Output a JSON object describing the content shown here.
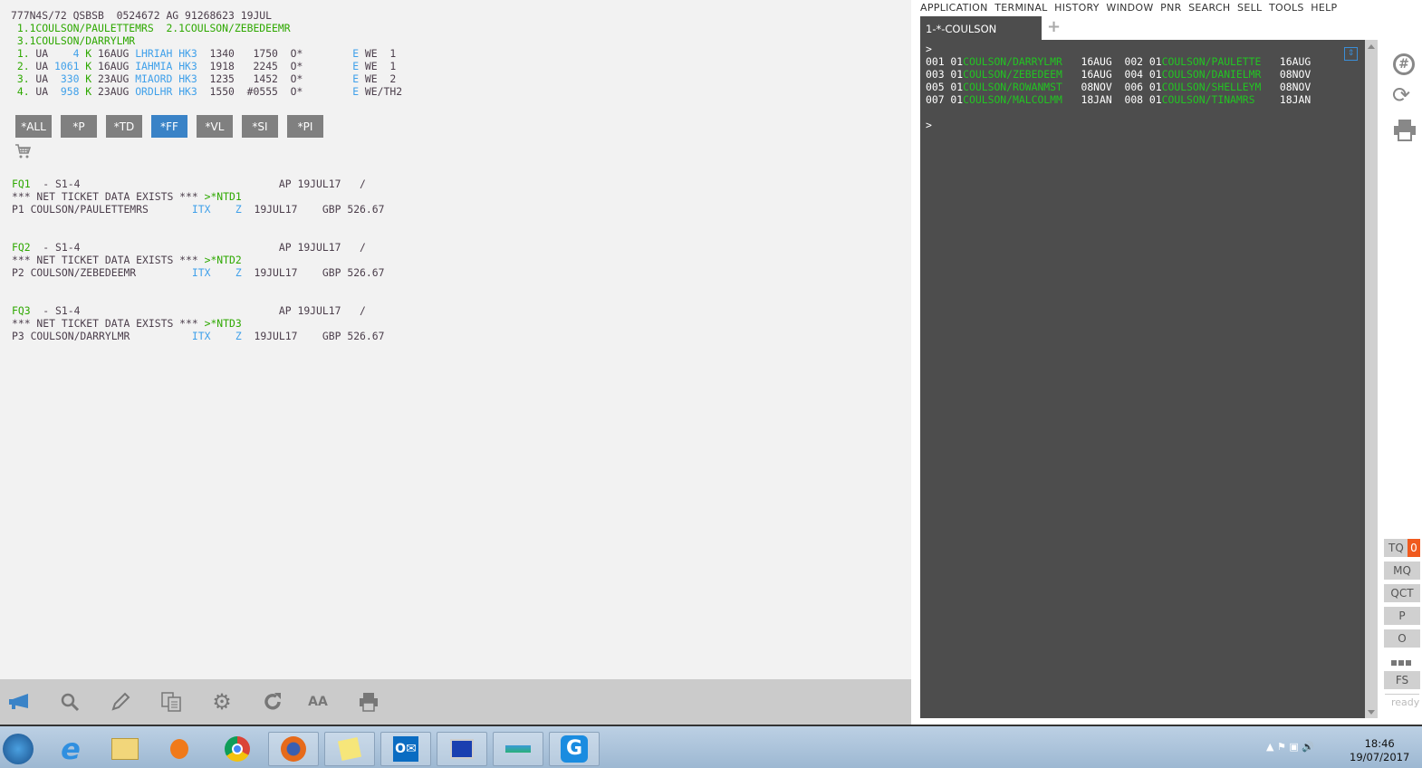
{
  "pnr_lines": [
    [
      [
        "777N4S/72 QSBSB  0524672 AG 91268623 19JUL",
        "d"
      ]
    ],
    [
      [
        " 1.1COULSON/PAULETTEMRS  2.1COULSON/ZEBEDEEMR",
        "g"
      ]
    ],
    [
      [
        " 3.1COULSON/DARRYLMR",
        "g"
      ]
    ],
    [
      [
        " 1.",
        "g"
      ],
      [
        " UA    ",
        "d"
      ],
      [
        "4",
        "b"
      ],
      [
        " K",
        "g"
      ],
      [
        " 16AUG ",
        "d"
      ],
      [
        "LHRIAH HK3",
        "b"
      ],
      [
        "  1340   1750  O*        ",
        "d"
      ],
      [
        "E",
        "b"
      ],
      [
        " WE  1",
        "d"
      ]
    ],
    [
      [
        " 2.",
        "g"
      ],
      [
        " UA ",
        "d"
      ],
      [
        "1061",
        "b"
      ],
      [
        " K",
        "g"
      ],
      [
        " 16AUG ",
        "d"
      ],
      [
        "IAHMIA HK3",
        "b"
      ],
      [
        "  1918   2245  O*        ",
        "d"
      ],
      [
        "E",
        "b"
      ],
      [
        " WE  1",
        "d"
      ]
    ],
    [
      [
        " 3.",
        "g"
      ],
      [
        " UA  ",
        "d"
      ],
      [
        "330",
        "b"
      ],
      [
        " K",
        "g"
      ],
      [
        " 23AUG ",
        "d"
      ],
      [
        "MIAORD HK3",
        "b"
      ],
      [
        "  1235   1452  O*        ",
        "d"
      ],
      [
        "E",
        "b"
      ],
      [
        " WE  2",
        "d"
      ]
    ],
    [
      [
        " 4.",
        "g"
      ],
      [
        " UA  ",
        "d"
      ],
      [
        "958",
        "b"
      ],
      [
        " K",
        "g"
      ],
      [
        " 23AUG ",
        "d"
      ],
      [
        "ORDLHR HK3",
        "b"
      ],
      [
        "  1550  #0555  O*        ",
        "d"
      ],
      [
        "E",
        "b"
      ],
      [
        " WE/TH2",
        "d"
      ]
    ]
  ],
  "quick_buttons": [
    {
      "label": "*ALL"
    },
    {
      "label": "*P"
    },
    {
      "label": "*TD"
    },
    {
      "label": "*FF",
      "active": true
    },
    {
      "label": "*VL"
    },
    {
      "label": "*SI"
    },
    {
      "label": "*PI"
    }
  ],
  "fare_lines": [
    [
      [
        "FQ1",
        "g"
      ],
      [
        "  - S1-4                                AP 19JUL17   /",
        "d"
      ]
    ],
    [
      [
        "*** NET TICKET DATA EXISTS *** ",
        "d"
      ],
      [
        ">*NTD1",
        "g"
      ]
    ],
    [
      [
        "P1 COULSON/PAULETTEMRS       ",
        "d"
      ],
      [
        "ITX",
        "b"
      ],
      [
        "    ",
        "d"
      ],
      [
        "Z",
        "b"
      ],
      [
        "  19JUL17    GBP 526.67",
        "d"
      ]
    ],
    [
      [
        "",
        ""
      ]
    ],
    [
      [
        "",
        ""
      ]
    ],
    [
      [
        "FQ2",
        "g"
      ],
      [
        "  - S1-4                                AP 19JUL17   /",
        "d"
      ]
    ],
    [
      [
        "*** NET TICKET DATA EXISTS *** ",
        "d"
      ],
      [
        ">*NTD2",
        "g"
      ]
    ],
    [
      [
        "P2 COULSON/ZEBEDEEMR         ",
        "d"
      ],
      [
        "ITX",
        "b"
      ],
      [
        "    ",
        "d"
      ],
      [
        "Z",
        "b"
      ],
      [
        "  19JUL17    GBP 526.67",
        "d"
      ]
    ],
    [
      [
        "",
        ""
      ]
    ],
    [
      [
        "",
        ""
      ]
    ],
    [
      [
        "FQ3",
        "g"
      ],
      [
        "  - S1-4                                AP 19JUL17   /",
        "d"
      ]
    ],
    [
      [
        "*** NET TICKET DATA EXISTS *** ",
        "d"
      ],
      [
        ">*NTD3",
        "g"
      ]
    ],
    [
      [
        "P3 COULSON/DARRYLMR          ",
        "d"
      ],
      [
        "ITX",
        "b"
      ],
      [
        "    ",
        "d"
      ],
      [
        "Z",
        "b"
      ],
      [
        "  19JUL17    GBP 526.67",
        "d"
      ]
    ]
  ],
  "toolbar_icons": [
    "megaphone-icon",
    "search-icon",
    "pencil-icon",
    "copy-icon",
    "gear-icon",
    "refresh-icon",
    "font-size-icon",
    "print-icon"
  ],
  "toolbar_font_label": "AA",
  "menu": "APPLICATION  TERMINAL  HISTORY  WINDOW  PNR  SEARCH  SELL  TOOLS  HELP",
  "tab_label": "1-*-COULSON",
  "terminal_lines": [
    [
      [
        ">",
        "w"
      ]
    ],
    [
      [
        "001 01",
        "w"
      ],
      [
        "COULSON/DARRYLMR",
        "tg"
      ],
      [
        "   16AUG  002 01",
        "w"
      ],
      [
        "COULSON/PAULETTE",
        "tg"
      ],
      [
        "   16AUG",
        "w"
      ]
    ],
    [
      [
        "003 01",
        "w"
      ],
      [
        "COULSON/ZEBEDEEM",
        "tg"
      ],
      [
        "   16AUG  004 01",
        "w"
      ],
      [
        "COULSON/DANIELMR",
        "tg"
      ],
      [
        "   08NOV",
        "w"
      ]
    ],
    [
      [
        "005 01",
        "w"
      ],
      [
        "COULSON/ROWANMST",
        "tg"
      ],
      [
        "   08NOV  006 01",
        "w"
      ],
      [
        "COULSON/SHELLEYM",
        "tg"
      ],
      [
        "   08NOV",
        "w"
      ]
    ],
    [
      [
        "007 01",
        "w"
      ],
      [
        "COULSON/MALCOLMM",
        "tg"
      ],
      [
        "   18JAN  008 01",
        "w"
      ],
      [
        "COULSON/TINAMRS",
        "tg"
      ],
      [
        "    18JAN",
        "w"
      ]
    ],
    [
      [
        "",
        ""
      ]
    ],
    [
      [
        ">",
        "w"
      ]
    ]
  ],
  "side_buttons": [
    {
      "label": "TQ",
      "badge": "0"
    },
    {
      "label": "MQ"
    },
    {
      "label": "QCT"
    },
    {
      "label": "P"
    },
    {
      "label": "O"
    },
    {
      "label": "FS"
    }
  ],
  "status": "ready",
  "clock": {
    "time": "18:46",
    "date": "19/07/2017"
  },
  "colors": {
    "accent": "#3a83c7",
    "badge": "#f05a1e",
    "green": "#2ea800",
    "blue": "#3fa0ea"
  }
}
